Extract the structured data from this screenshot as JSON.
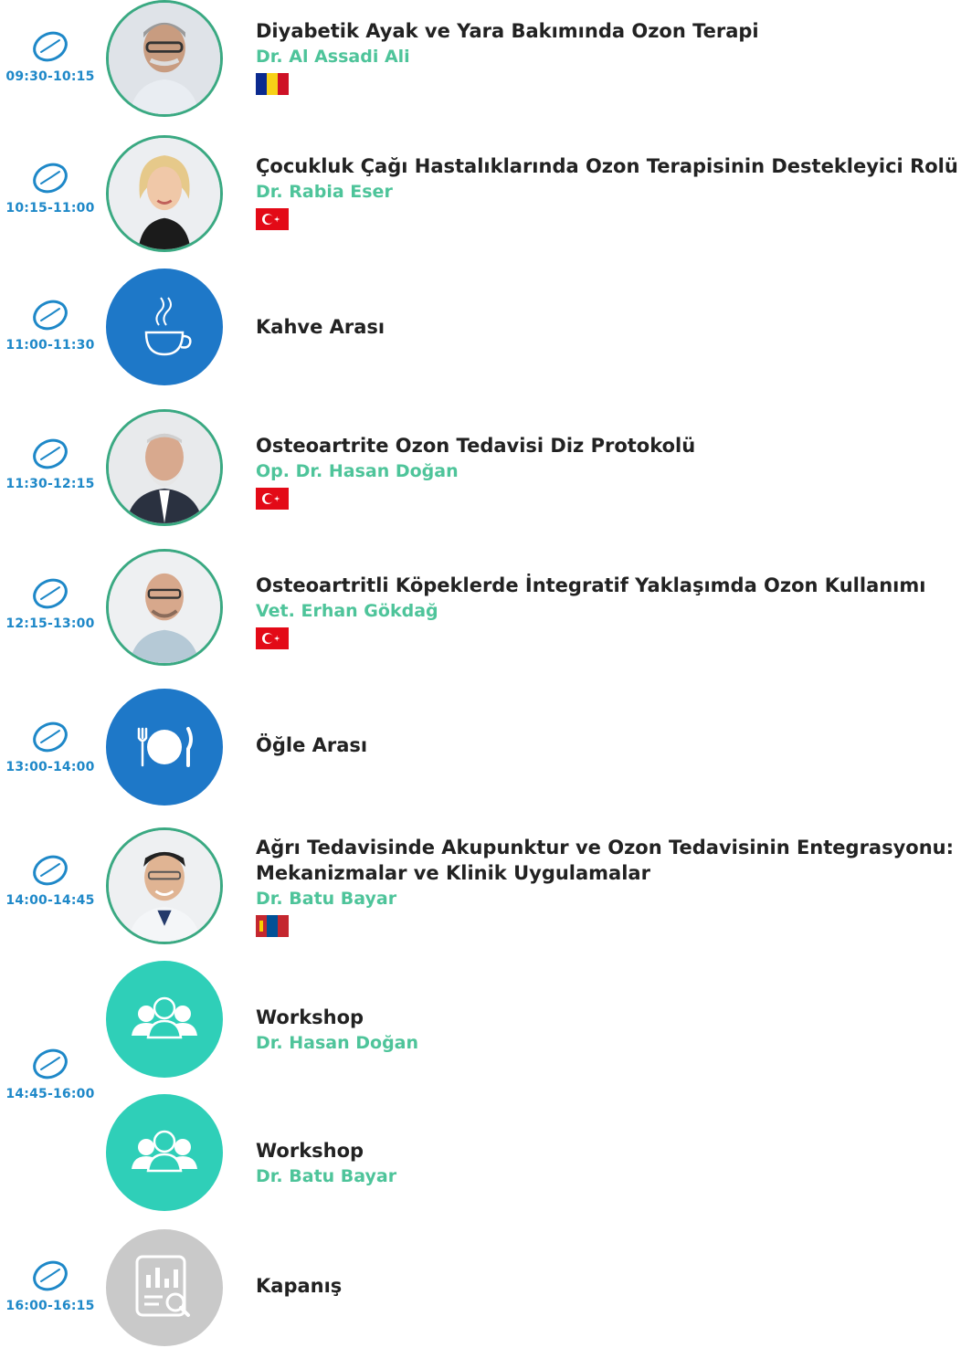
{
  "sessions": [
    {
      "time": "09:30-10:15",
      "title": "Diyabetik Ayak ve Yara Bakımında Ozon Terapi",
      "speaker": "Dr. Al Assadi Ali",
      "flag": "romania-flag-icon",
      "avatar": "speaker-photo"
    },
    {
      "time": "10:15-11:00",
      "title": "Çocukluk Çağı Hastalıklarında Ozon Terapisinin Destekleyici Rolü",
      "speaker": "Dr. Rabia Eser",
      "flag": "turkey-flag-icon",
      "avatar": "speaker-photo"
    },
    {
      "time": "11:00-11:30",
      "title": "Kahve Arası",
      "icon": "coffee-cup-icon"
    },
    {
      "time": "11:30-12:15",
      "title": "Osteoartrite Ozon Tedavisi Diz Protokolü",
      "speaker": "Op. Dr. Hasan Doğan",
      "flag": "turkey-flag-icon",
      "avatar": "speaker-photo"
    },
    {
      "time": "12:15-13:00",
      "title": "Osteoartritli Köpeklerde İntegratif Yaklaşımda Ozon Kullanımı",
      "speaker": "Vet. Erhan Gökdağ",
      "flag": "turkey-flag-icon",
      "avatar": "speaker-photo"
    },
    {
      "time": "13:00-14:00",
      "title": "Öğle Arası",
      "icon": "plate-fork-knife-icon"
    },
    {
      "time": "14:00-14:45",
      "title_line1": "Ağrı Tedavisinde Akupunktur ve Ozon Tedavisinin Entegrasyonu:",
      "title_line2": "Mekanizmalar ve Klinik Uygulamalar",
      "speaker": "Dr. Batu Bayar",
      "flag": "mongolia-flag-icon",
      "avatar": "speaker-photo"
    },
    {
      "time": "14:45-16:00",
      "workshops": [
        {
          "title": "Workshop",
          "speaker": "Dr. Hasan Doğan",
          "icon": "group-people-icon"
        },
        {
          "title": "Workshop",
          "speaker": "Dr. Batu Bayar",
          "icon": "group-people-icon"
        }
      ]
    },
    {
      "time": "16:00-16:15",
      "title": "Kapanış",
      "icon": "report-search-icon"
    }
  ],
  "colors": {
    "time": "#1e88c8",
    "speaker": "#4ec49a",
    "title": "#222222",
    "break_icon_bg": "#1e78c8",
    "workshop_icon_bg": "#2fcfb8",
    "closing_icon_bg": "#c9c9c9",
    "photo_border": "#3aa982"
  }
}
